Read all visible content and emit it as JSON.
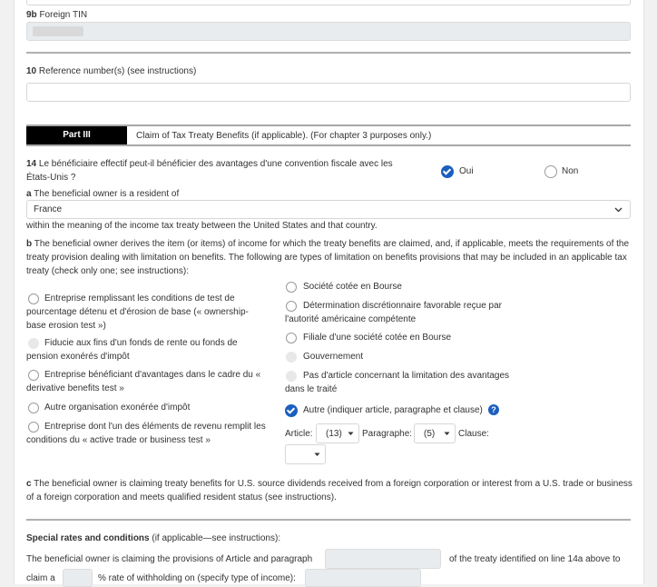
{
  "line9b": {
    "num": "9b",
    "label": "Foreign TIN"
  },
  "line10": {
    "num": "10",
    "label": "Reference number(s) (see instructions)"
  },
  "part3": {
    "tag": "Part III",
    "title": "Claim of Tax Treaty Benefits (if applicable). (For chapter 3 purposes only.)"
  },
  "q14": {
    "num": "14",
    "text": "Le bénéficiaire effectif peut-il bénéficier des avantages d'une convention fiscale avec les États-Unis ?",
    "yes": "Oui",
    "no": "Non",
    "selected": "Oui"
  },
  "q14a": {
    "letter": "a",
    "label": "The beneficial owner is a resident of",
    "country": "France",
    "after": "within the meaning of the income tax treaty between the United States and that country."
  },
  "q14b": {
    "letter": "b",
    "text": "The beneficial owner derives the item (or items) of income for which the treaty benefits are claimed, and, if applicable, meets the requirements of the treaty provision dealing with limitation on benefits. The following are types of limitation on benefits provisions that may be included in an applicable tax treaty (check only one; see instructions):",
    "left_options": [
      {
        "label": "Entreprise remplissant les conditions de test de pourcentage détenu et d'érosion de base (« ownership-base erosion test »)",
        "state": "unchecked"
      },
      {
        "label": "Fiducie aux fins d'un fonds de rente ou fonds de pension exonérés d'impôt",
        "state": "disabled"
      },
      {
        "label": "Entreprise bénéficiant d'avantages dans le cadre du « derivative benefits test »",
        "state": "unchecked"
      },
      {
        "label": "Autre organisation exonérée d'impôt",
        "state": "unchecked"
      },
      {
        "label": "Entreprise dont l'un des éléments de revenu remplit les conditions du « active trade or business test »",
        "state": "unchecked"
      }
    ],
    "right_options": [
      {
        "label": "Société cotée en Bourse",
        "state": "unchecked"
      },
      {
        "label": "Détermination discrétionnaire favorable reçue par l'autorité américaine compétente",
        "state": "unchecked"
      },
      {
        "label": "Filiale d'une société cotée en Bourse",
        "state": "unchecked"
      },
      {
        "label": "Gouvernement",
        "state": "disabled"
      },
      {
        "label": "Pas d'article concernant la limitation des avantages dans le traité",
        "state": "disabled"
      },
      {
        "label": "Autre (indiquer article, paragraphe et clause)",
        "state": "checked"
      }
    ],
    "help_icon": "question-circle-icon",
    "article_label": "Article:",
    "article_value": "(13)",
    "paragraph_label": "Paragraphe:",
    "paragraph_value": "(5)",
    "clause_label": "Clause:",
    "clause_value": ""
  },
  "q14c": {
    "letter": "c",
    "text": "The beneficial owner is claiming treaty benefits for U.S. source dividends received from a foreign corporation or interest from a U.S. trade or business of a foreign corporation and meets qualified resident status (see instructions)."
  },
  "special": {
    "title": "Special rates and conditions",
    "title_suffix": " (if applicable—see instructions):",
    "line1_a": "The beneficial owner is claiming the provisions of Article and paragraph",
    "line1_b": "of the treaty identified on line 14a above to",
    "line2_a": "claim a",
    "line2_b": "% rate of withholding on (specify type of income):"
  },
  "colors": {
    "accent": "#1d5fbf",
    "part_bar": "#000000",
    "rule": "#b0b0b0"
  }
}
